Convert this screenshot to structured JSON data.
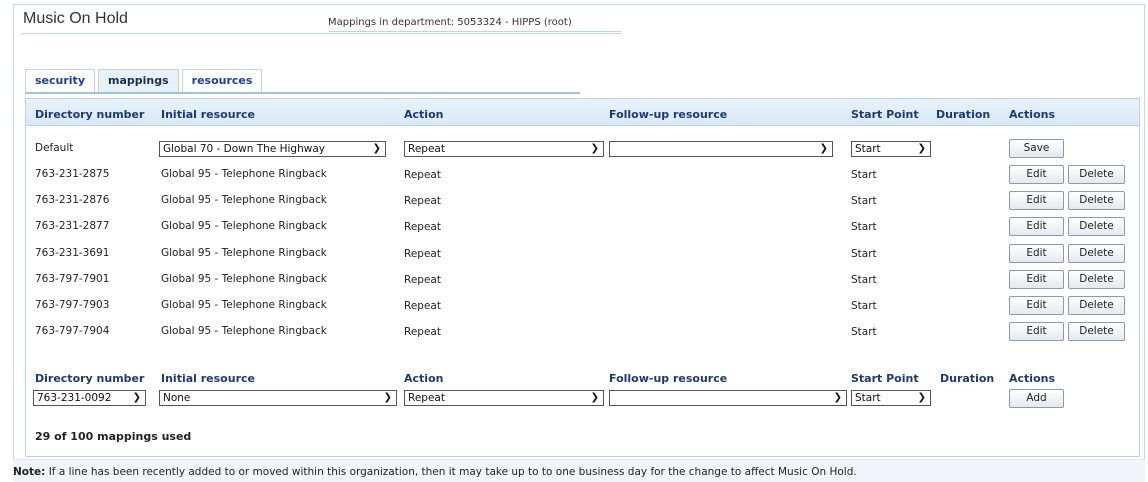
{
  "page": {
    "title": "Music On Hold",
    "subtitle": "Mappings in department: 5053324 - HIPPS (root)"
  },
  "tabs": [
    {
      "label": "security"
    },
    {
      "label": "mappings"
    },
    {
      "label": "resources"
    }
  ],
  "columns": {
    "directory": "Directory number",
    "initial": "Initial resource",
    "action": "Action",
    "followup": "Follow-up resource",
    "start": "Start Point",
    "duration": "Duration",
    "actions": "Actions"
  },
  "default_row": {
    "directory": "Default",
    "initial": "Global 70 - Down The Highway",
    "action": "Repeat",
    "followup": "",
    "start": "Start",
    "save_label": "Save"
  },
  "rows": [
    {
      "directory": "763-231-2875",
      "initial": "Global 95 - Telephone Ringback",
      "action": "Repeat",
      "start": "Start"
    },
    {
      "directory": "763-231-2876",
      "initial": "Global 95 - Telephone Ringback",
      "action": "Repeat",
      "start": "Start"
    },
    {
      "directory": "763-231-2877",
      "initial": "Global 95 - Telephone Ringback",
      "action": "Repeat",
      "start": "Start"
    },
    {
      "directory": "763-231-3691",
      "initial": "Global 95 - Telephone Ringback",
      "action": "Repeat",
      "start": "Start"
    },
    {
      "directory": "763-797-7901",
      "initial": "Global 95 - Telephone Ringback",
      "action": "Repeat",
      "start": "Start"
    },
    {
      "directory": "763-797-7903",
      "initial": "Global 95 - Telephone Ringback",
      "action": "Repeat",
      "start": "Start"
    },
    {
      "directory": "763-797-7904",
      "initial": "Global 95 - Telephone Ringback",
      "action": "Repeat",
      "start": "Start"
    }
  ],
  "row_buttons": {
    "edit": "Edit",
    "delete": "Delete"
  },
  "add_row": {
    "directory": "763-231-0092",
    "initial": "None",
    "action": "Repeat",
    "followup": "",
    "start": "Start",
    "add_label": "Add"
  },
  "usage": "29 of 100 mappings used",
  "note": {
    "label": "Note:",
    "text": "If a line has been recently added to or moved within this organization, then it may take up to to one business day for the change to affect Music On Hold."
  },
  "icons": {
    "dropdown": "chevron-down-icon"
  }
}
